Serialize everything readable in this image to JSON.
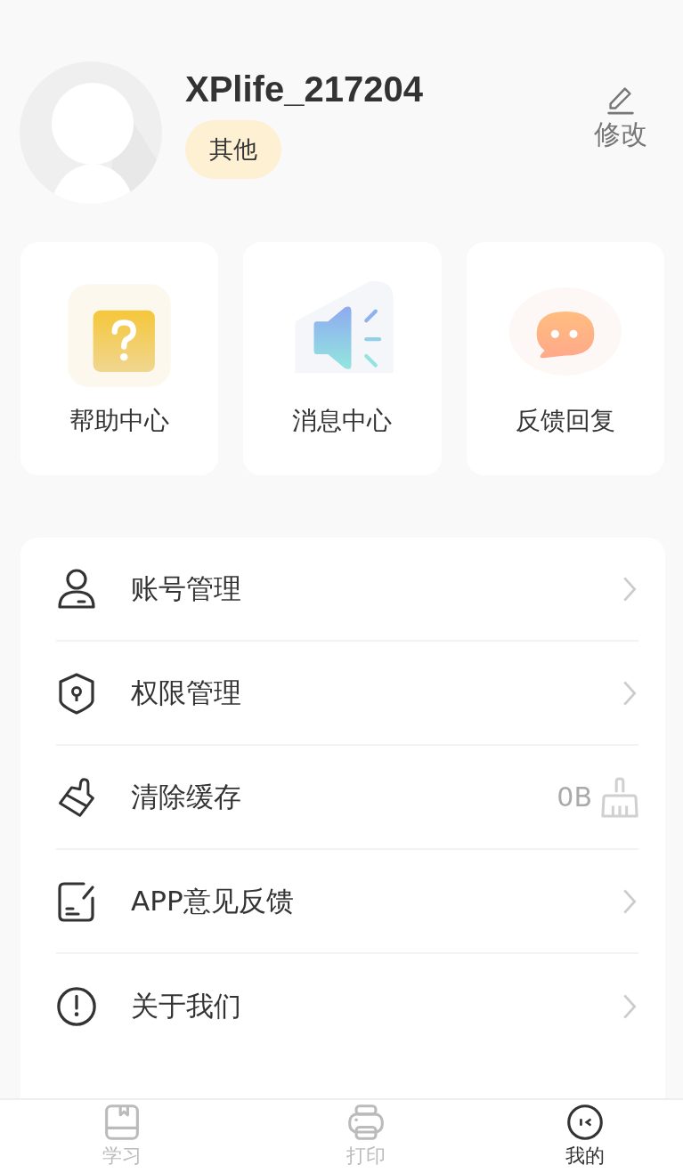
{
  "profile": {
    "username": "XPlife_217204",
    "tag": "其他",
    "edit_label": "修改"
  },
  "shortcuts": [
    {
      "label": "帮助中心"
    },
    {
      "label": "消息中心"
    },
    {
      "label": "反馈回复"
    }
  ],
  "menu": [
    {
      "kind": "link",
      "label": "账号管理"
    },
    {
      "kind": "link",
      "label": "权限管理"
    },
    {
      "kind": "cache",
      "label": "清除缓存",
      "value": "0B"
    },
    {
      "kind": "link",
      "label": "APP意见反馈"
    },
    {
      "kind": "link",
      "label": "关于我们"
    }
  ],
  "tab_bar": [
    {
      "label": "学习",
      "selected": false
    },
    {
      "label": "打印",
      "selected": false
    },
    {
      "label": "我的",
      "selected": true
    }
  ]
}
